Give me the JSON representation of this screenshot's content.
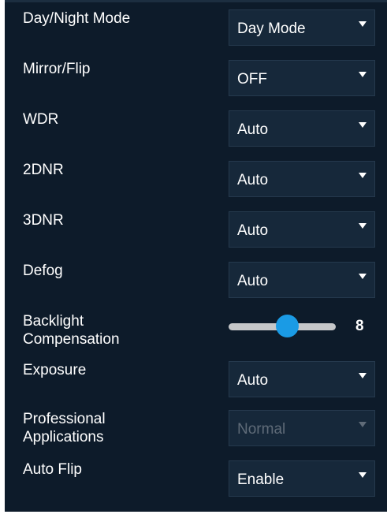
{
  "settings": {
    "day_night_mode": {
      "label": "Day/Night Mode",
      "value": "Day Mode"
    },
    "mirror_flip": {
      "label": "Mirror/Flip",
      "value": "OFF"
    },
    "wdr": {
      "label": "WDR",
      "value": "Auto"
    },
    "dnr_2d": {
      "label": "2DNR",
      "value": "Auto"
    },
    "dnr_3d": {
      "label": "3DNR",
      "value": "Auto"
    },
    "defog": {
      "label": "Defog",
      "value": "Auto"
    },
    "backlight": {
      "label": "Backlight\nCompensation",
      "value": "8"
    },
    "exposure": {
      "label": "Exposure",
      "value": "Auto"
    },
    "professional": {
      "label": "Professional\nApplications",
      "value": "Normal",
      "disabled": true
    },
    "auto_flip": {
      "label": "Auto Flip",
      "value": "Enable"
    }
  },
  "colors": {
    "panel_background": "#0d1b2a",
    "select_background": "#16283a",
    "slider_thumb": "#1a9be5",
    "slider_track": "#c5c7c9",
    "disabled_text": "#5f6b78"
  },
  "icons": {
    "dropdown": "triangle-down-icon"
  }
}
